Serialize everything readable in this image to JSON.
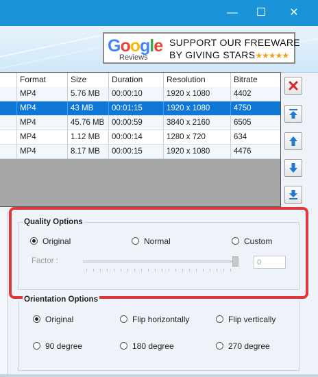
{
  "window": {
    "minimize_glyph": "—",
    "maximize_glyph": "☐",
    "close_glyph": "✕"
  },
  "banner": {
    "google_letters": [
      "G",
      "o",
      "o",
      "g",
      "l",
      "e"
    ],
    "google_colors": [
      "#4285F4",
      "#EA4335",
      "#FBBC05",
      "#4285F4",
      "#34A853",
      "#EA4335"
    ],
    "reviews": "Reviews",
    "line1": "SUPPORT OUR FREEWARE",
    "line2": "BY GIVING STARS",
    "stars": "★★★★★"
  },
  "table": {
    "columns": [
      "Format",
      "Size",
      "Duration",
      "Resolution",
      "Bitrate"
    ],
    "rows": [
      {
        "format": "MP4",
        "size": "5.76 MB",
        "duration": "00:00:10",
        "resolution": "1920 x 1080",
        "bitrate": "4402"
      },
      {
        "format": "MP4",
        "size": "43 MB",
        "duration": "00:01:15",
        "resolution": "1920 x 1080",
        "bitrate": "4750"
      },
      {
        "format": "MP4",
        "size": "45.76 MB",
        "duration": "00:00:59",
        "resolution": "3840 x 2160",
        "bitrate": "6505"
      },
      {
        "format": "MP4",
        "size": "1.12 MB",
        "duration": "00:00:14",
        "resolution": "1280 x 720",
        "bitrate": "634"
      },
      {
        "format": "MP4",
        "size": "8.17 MB",
        "duration": "00:00:15",
        "resolution": "1920 x 1080",
        "bitrate": "4476"
      }
    ],
    "selected_row": 1
  },
  "side_buttons": [
    "remove-icon",
    "move-top-icon",
    "move-up-icon",
    "move-down-icon",
    "move-bottom-icon"
  ],
  "quality": {
    "title": "Quality Options",
    "options": [
      "Original",
      "Normal",
      "Custom"
    ],
    "selected": "Original",
    "factor_label": "Factor :",
    "factor_value": "0"
  },
  "orientation": {
    "title": "Orientation Options",
    "options": [
      "Original",
      "Flip horizontally",
      "Flip vertically",
      "90 degree",
      "180 degree",
      "270 degree"
    ],
    "selected": "Original"
  }
}
